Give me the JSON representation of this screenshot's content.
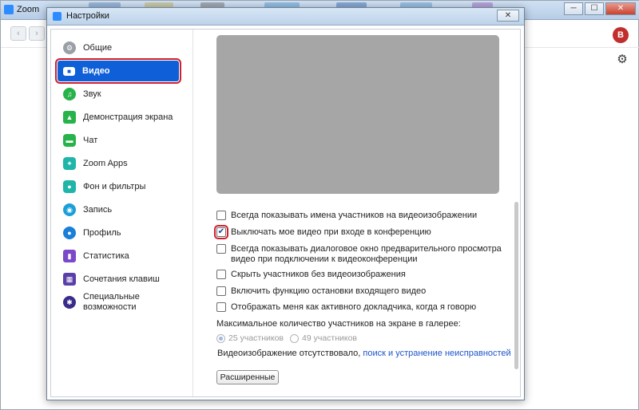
{
  "background_window": {
    "title": "Zoom",
    "avatar_letter": "B",
    "nav_back": "‹",
    "nav_forward": "›",
    "controls": {
      "minimize": "─",
      "maximize": "☐",
      "close": "✕"
    }
  },
  "dialog": {
    "title": "Настройки",
    "close_glyph": "✕"
  },
  "sidebar": {
    "items": [
      {
        "label": "Общие",
        "icon": "gear-icon",
        "color": "#9aa0a6",
        "active": false
      },
      {
        "label": "Видео",
        "icon": "video-camera-icon",
        "color": "#ffffff",
        "active": true
      },
      {
        "label": "Звук",
        "icon": "headphones-icon",
        "color": "#28b34a",
        "active": false
      },
      {
        "label": "Демонстрация экрана",
        "icon": "screen-share-icon",
        "color": "#28b34a",
        "active": false
      },
      {
        "label": "Чат",
        "icon": "chat-icon",
        "color": "#28b34a",
        "active": false
      },
      {
        "label": "Zoom Apps",
        "icon": "apps-icon",
        "color": "#1fb5a8",
        "active": false
      },
      {
        "label": "Фон и фильтры",
        "icon": "background-filters-icon",
        "color": "#1fb5a8",
        "active": false
      },
      {
        "label": "Запись",
        "icon": "record-icon",
        "color": "#1aa0d8",
        "active": false
      },
      {
        "label": "Профиль",
        "icon": "profile-icon",
        "color": "#1a7fd8",
        "active": false
      },
      {
        "label": "Статистика",
        "icon": "statistics-icon",
        "color": "#7a48c8",
        "active": false
      },
      {
        "label": "Сочетания клавиш",
        "icon": "keyboard-icon",
        "color": "#5a3fa8",
        "active": false
      },
      {
        "label": "Специальные возможности",
        "icon": "accessibility-icon",
        "color": "#3a2d8a",
        "active": false
      }
    ]
  },
  "video": {
    "options": [
      {
        "label": "Всегда показывать имена участников на видеоизображении",
        "checked": false
      },
      {
        "label": "Выключать мое видео при входе в конференцию",
        "checked": true
      },
      {
        "label": "Всегда показывать диалоговое окно предварительного просмотра видео при подключении к видеоконференции",
        "checked": false
      },
      {
        "label": "Скрыть участников без видеоизображения",
        "checked": false
      },
      {
        "label": "Включить функцию остановки входящего видео",
        "checked": false
      },
      {
        "label": "Отображать меня как активного докладчика, когда я говорю",
        "checked": false
      }
    ],
    "gallery_label": "Максимальное количество участников на экране в галерее:",
    "gallery_options": [
      {
        "label": "25 участников",
        "selected": true
      },
      {
        "label": "49 участников",
        "selected": false
      }
    ],
    "troubleshoot_text": "Видеоизображение отсутствовало,",
    "troubleshoot_link": "поиск и устранение неисправностей",
    "advanced_button": "Расширенные"
  }
}
